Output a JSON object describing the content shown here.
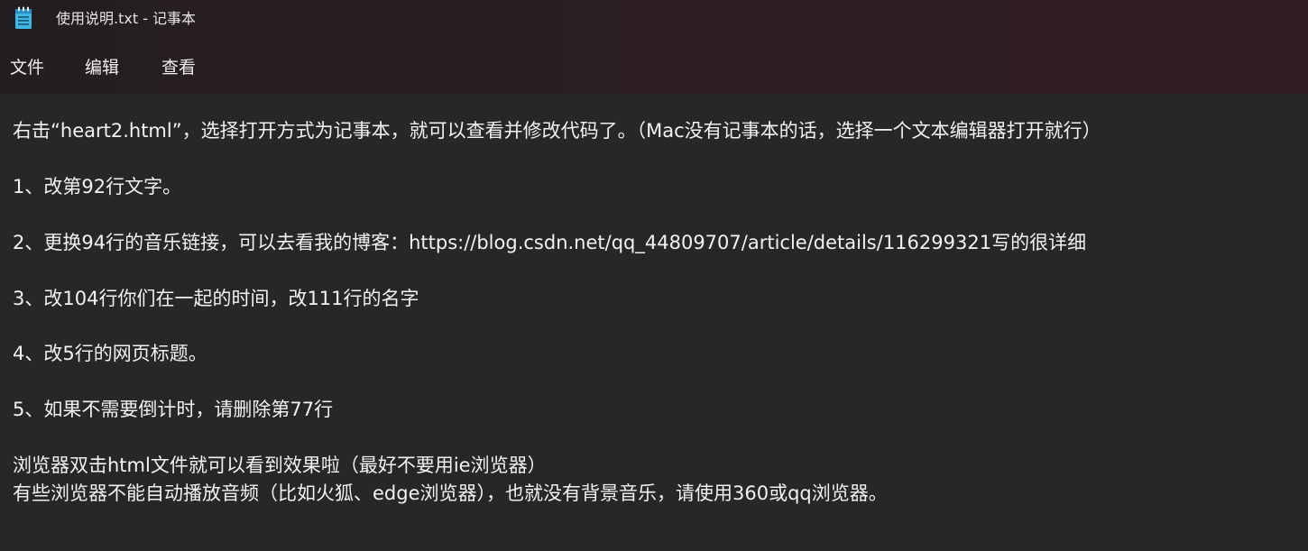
{
  "window": {
    "title": "使用说明.txt - 记事本"
  },
  "icons": {
    "app": "notepad-icon"
  },
  "menu": {
    "file": "文件",
    "edit": "编辑",
    "view": "查看"
  },
  "document": {
    "lines": [
      "右击“heart2.html”，选择打开方式为记事本，就可以查看并修改代码了。（Mac没有记事本的话，选择一个文本编辑器打开就行）",
      "1、改第92行文字。",
      "2、更换94行的音乐链接，可以去看我的博客：https://blog.csdn.net/qq_44809707/article/details/116299321写的很详细",
      "3、改104行你们在一起的时间，改111行的名字",
      "4、改5行的网页标题。",
      "5、如果不需要倒计时，请删除第77行",
      "浏览器双击html文件就可以看到效果啦（最好不要用ie浏览器）",
      "有些浏览器不能自动播放音频（比如火狐、edge浏览器），也就没有背景音乐，请使用360或qq浏览器。"
    ]
  },
  "colors": {
    "editor_background": "#272727",
    "text": "#f2f2f2",
    "icon_accent": "#3fb7e4"
  }
}
